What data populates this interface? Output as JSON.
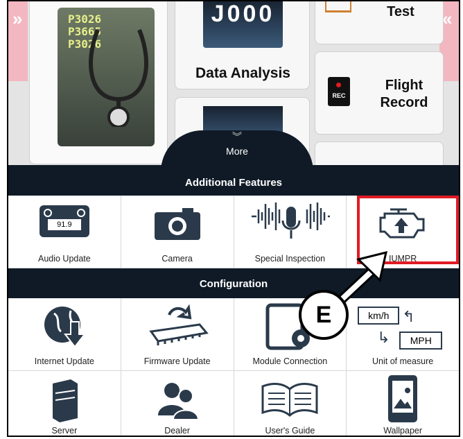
{
  "top": {
    "codes": [
      "P3026",
      "P3665",
      "P3026"
    ],
    "tile_partial_number": "J000",
    "data_analysis_label": "Data Analysis",
    "test_label": "Test",
    "flight_record_label": "Flight\nRecord",
    "rec_label": "REC",
    "more_label": "More"
  },
  "sections": {
    "additional_title": "Additional Features",
    "configuration_title": "Configuration"
  },
  "additional": [
    {
      "label": "Audio Update",
      "icon": "radio-icon",
      "display": "91.9"
    },
    {
      "label": "Camera",
      "icon": "camera-icon"
    },
    {
      "label": "Special Inspection",
      "icon": "sound-wave-mic-icon"
    },
    {
      "label": "IUMPR",
      "icon": "engine-icon"
    }
  ],
  "config_row1": [
    {
      "label": "Internet Update",
      "icon": "globe-download-icon"
    },
    {
      "label": "Firmware Update",
      "icon": "chip-refresh-icon"
    },
    {
      "label": "Module Connection",
      "icon": "tablet-gear-icon"
    },
    {
      "label": "Unit of measure",
      "icon": "unit-convert-icon",
      "unit_a": "km/h",
      "unit_b": "MPH"
    }
  ],
  "config_row2": [
    {
      "label": "Server",
      "icon": "server-icon"
    },
    {
      "label": "Dealer",
      "icon": "people-icon"
    },
    {
      "label": "User's Guide",
      "icon": "book-icon"
    },
    {
      "label": "Wallpaper",
      "icon": "wallpaper-icon"
    }
  ],
  "annotation": {
    "callout_letter": "E"
  },
  "colors": {
    "dark_header": "#0f1a26",
    "highlight": "#e01b24",
    "edge": "#f2b7c0"
  }
}
